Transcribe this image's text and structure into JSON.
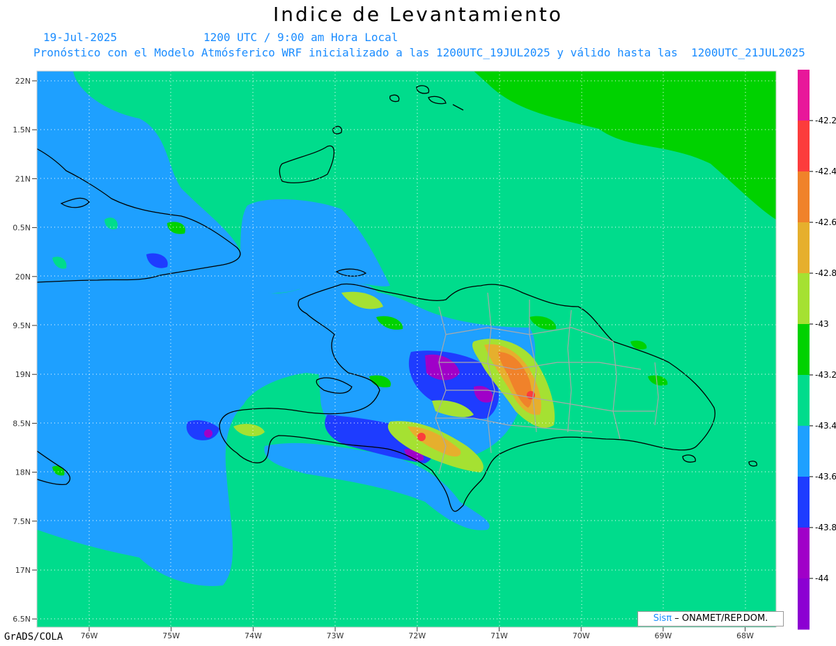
{
  "title": "Indice de Levantamiento",
  "date": "19-Jul-2025",
  "time": "1200 UTC / 9:00 am Hora Local",
  "description": "Pronóstico con el Modelo Atmósferico WRF inicializado a las 1200UTC_19JUL2025 y válido hasta las  1200UTC_21JUL2025",
  "lat_labels": [
    "22N",
    "1.5N",
    "21N",
    "0.5N",
    "20N",
    "9.5N",
    "19N",
    "8.5N",
    "18N",
    "7.5N",
    "17N",
    "6.5N"
  ],
  "lon_labels": [
    "76W",
    "75W",
    "74W",
    "73W",
    "72W",
    "71W",
    "70W",
    "69W",
    "68W"
  ],
  "colorbar": {
    "labels": [
      "-42.2",
      "-42.4",
      "-42.6",
      "-42.8",
      "-43",
      "-43.2",
      "-43.4",
      "-43.6",
      "-43.8",
      "-44"
    ],
    "colors": [
      "#e8179a",
      "#fc3c3c",
      "#f0822a",
      "#e6af2d",
      "#a5e132",
      "#00d200",
      "#00dc8c",
      "#1ea0ff",
      "#1e3cff",
      "#a000c8",
      "#8c00d2"
    ]
  },
  "credit": {
    "brand": "Sisπ",
    "text": " – ONAMET/REP.DOM."
  },
  "footer": "GrADS/COLA"
}
